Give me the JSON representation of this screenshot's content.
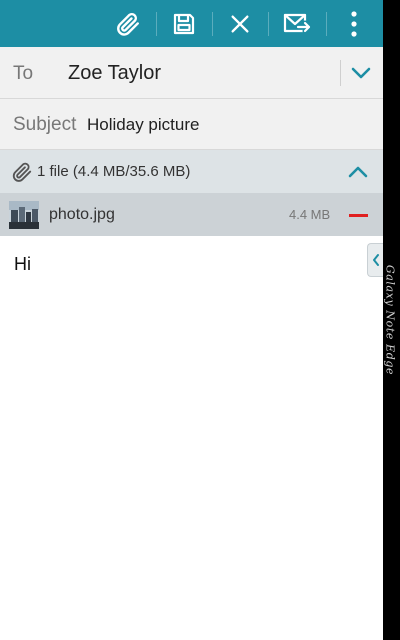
{
  "toolbar": {
    "actions": [
      {
        "name": "attach",
        "icon": "paperclip-icon"
      },
      {
        "name": "save",
        "icon": "save-icon"
      },
      {
        "name": "discard",
        "icon": "close-icon"
      },
      {
        "name": "send",
        "icon": "send-mail-icon"
      },
      {
        "name": "more",
        "icon": "more-vertical-icon"
      }
    ]
  },
  "compose": {
    "to_label": "To",
    "to_value": "Zoe Taylor",
    "subject_label": "Subject",
    "subject_value": "Holiday picture",
    "body": "Hi"
  },
  "attachments": {
    "summary": "1 file (4.4 MB/35.6 MB)",
    "items": [
      {
        "name": "photo.jpg",
        "size": "4.4 MB"
      }
    ]
  },
  "device": {
    "brand": "Galaxy Note Edge"
  },
  "colors": {
    "action_bar": "#1d8ea4",
    "accent": "#1d8ea4",
    "remove": "#e02020",
    "field_bg": "#f1f1f1",
    "attach_header_bg": "#dde3e6",
    "attach_item_bg": "#ccd2d6"
  }
}
